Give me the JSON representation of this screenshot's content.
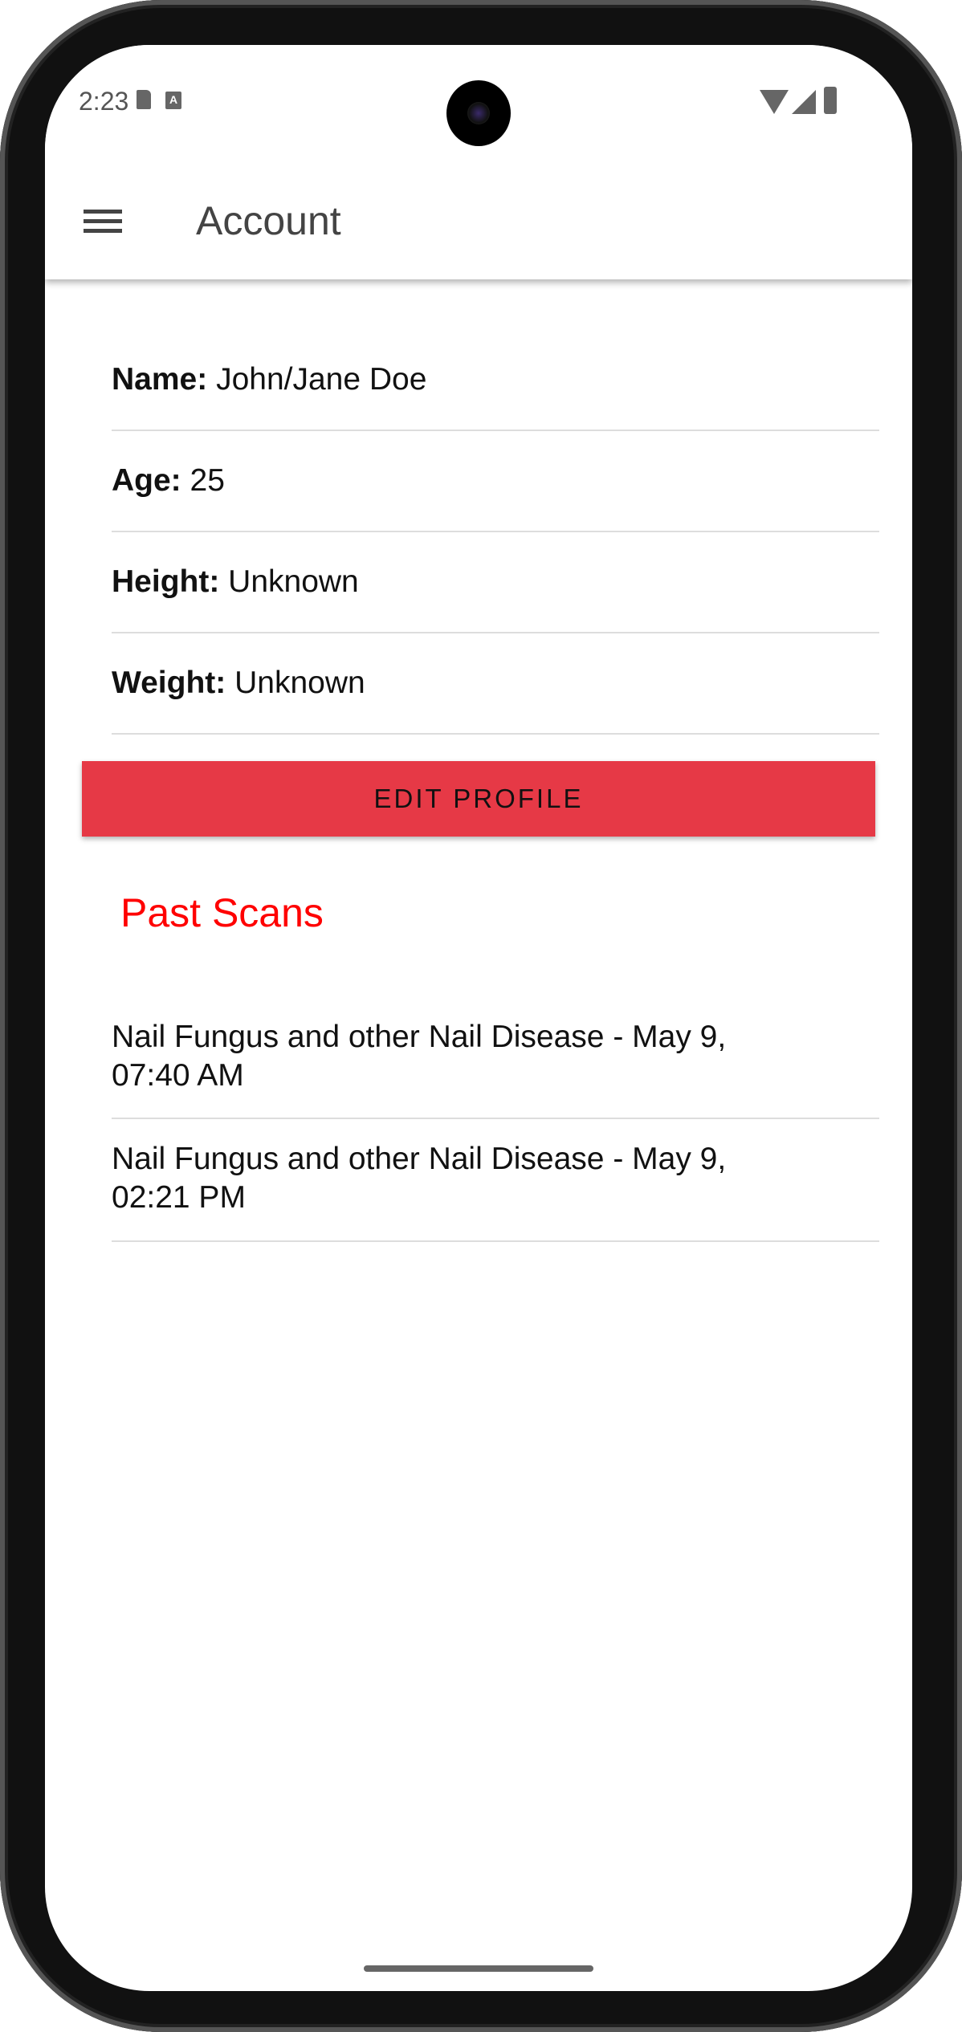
{
  "status_bar": {
    "time": "2:23",
    "icons": [
      "sd-card-icon",
      "text-a-icon",
      "wifi-icon",
      "signal-icon",
      "battery-icon"
    ]
  },
  "app_bar": {
    "title": "Account",
    "menu_icon": "hamburger-menu-icon"
  },
  "profile": {
    "fields": [
      {
        "label": "Name:",
        "value": "John/Jane Doe"
      },
      {
        "label": "Age:",
        "value": "25"
      },
      {
        "label": "Height:",
        "value": "Unknown"
      },
      {
        "label": "Weight:",
        "value": "Unknown"
      }
    ],
    "edit_button": "EDIT PROFILE"
  },
  "past_scans": {
    "heading": "Past Scans",
    "items": [
      {
        "line1": "Nail Fungus and other Nail Disease - May 9,",
        "line2": "07:40 AM"
      },
      {
        "line1": "Nail Fungus and other Nail Disease - May 9,",
        "line2": "02:21 PM"
      }
    ]
  },
  "colors": {
    "accent_button": "#e63946",
    "heading_red": "#ff0000"
  }
}
